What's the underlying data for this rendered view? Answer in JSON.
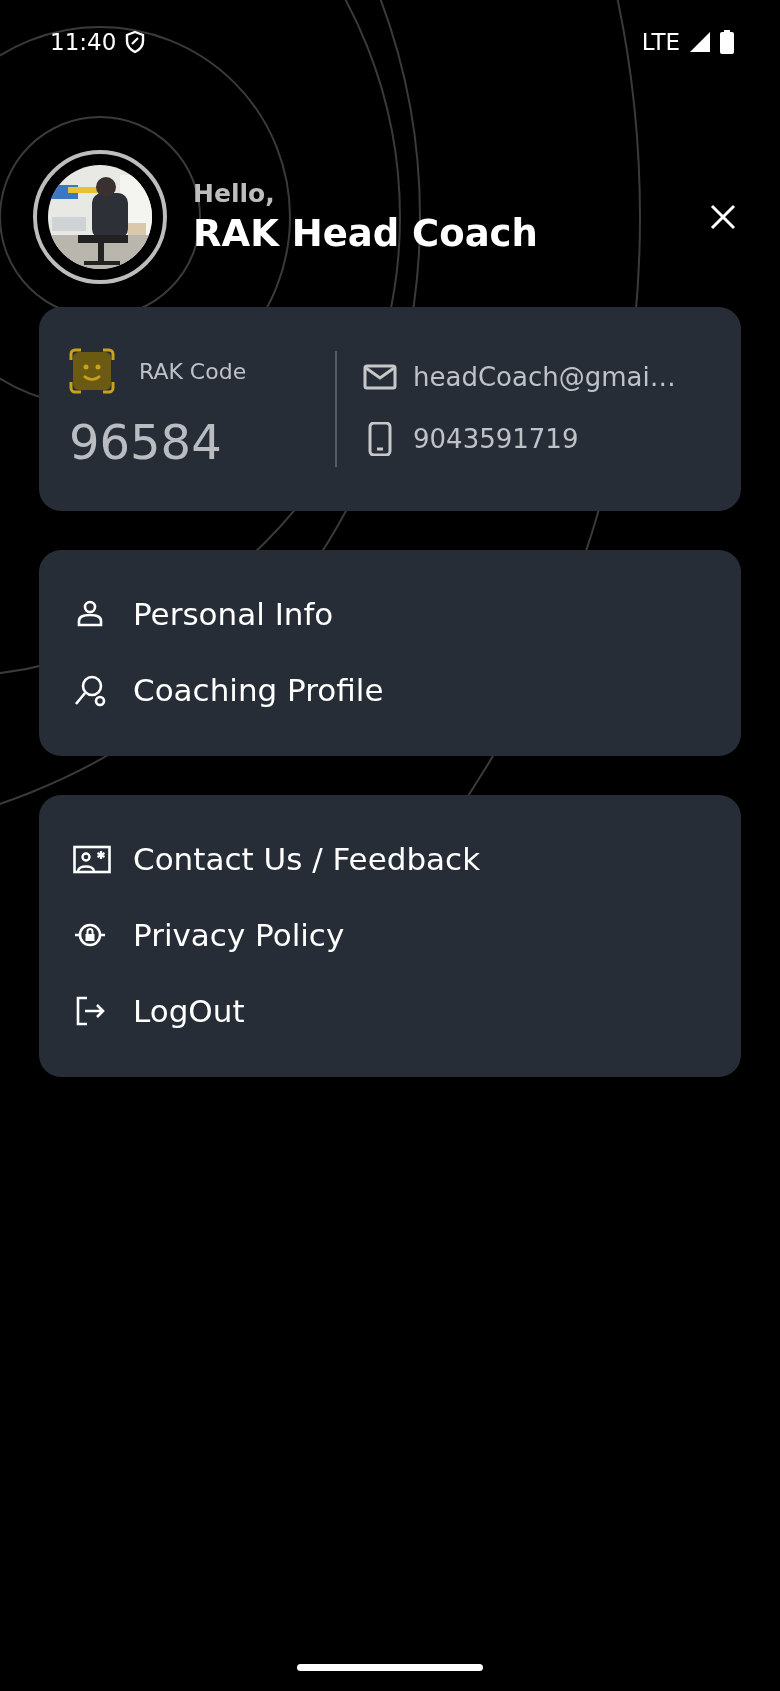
{
  "status_bar": {
    "time": "11:40",
    "network": "LTE"
  },
  "header": {
    "greeting": "Hello,",
    "name": "RAK Head Coach"
  },
  "profile_card": {
    "code_label": "RAK Code",
    "code": "96584",
    "email": "headCoach@gmai…",
    "phone": "9043591719"
  },
  "menu_groups": [
    {
      "items": [
        {
          "kind": "person",
          "label": "Personal Info"
        },
        {
          "kind": "coach",
          "label": "Coaching Profile"
        }
      ]
    },
    {
      "items": [
        {
          "kind": "contact",
          "label": "Contact Us / Feedback"
        },
        {
          "kind": "privacy",
          "label": "Privacy Policy"
        },
        {
          "kind": "logout",
          "label": "LogOut"
        }
      ]
    }
  ]
}
